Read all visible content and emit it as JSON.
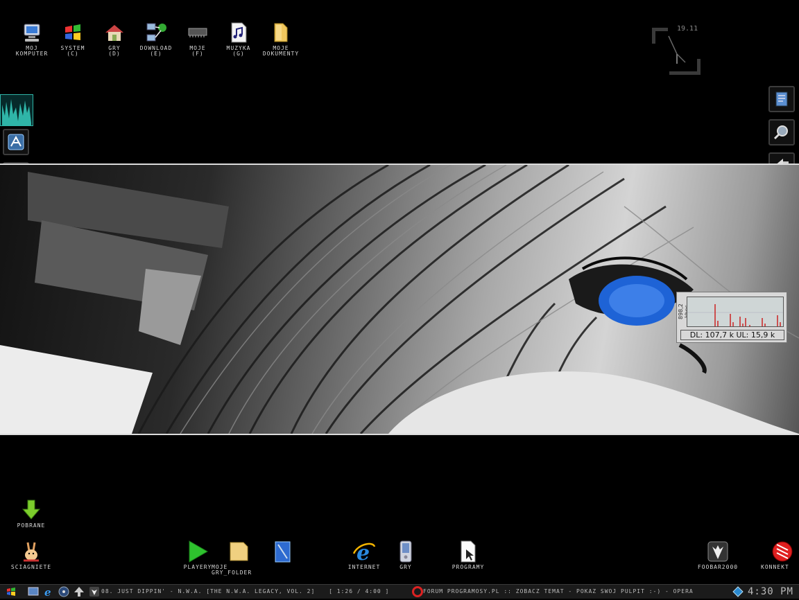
{
  "desktop_icons_top": [
    {
      "label": "MOJ\nKOMPUTER",
      "icon": "computer-icon"
    },
    {
      "label": "SYSTEM\n(C)",
      "icon": "windows-logo-icon"
    },
    {
      "label": "GRY\n(D)",
      "icon": "home-icon"
    },
    {
      "label": "DOWNLOAD\n(E)",
      "icon": "network-icon"
    },
    {
      "label": "MOJE\n(F)",
      "icon": "memory-chip-icon"
    },
    {
      "label": "MUZYKA\n(G)",
      "icon": "music-file-icon"
    },
    {
      "label": "MOJE\nDOKUMENTY",
      "icon": "folder-icon"
    }
  ],
  "clock": {
    "time": "19.11"
  },
  "desktop_icons_bottom": [
    {
      "label": "POBRANE",
      "icon": "download-arrow-icon"
    },
    {
      "label": "SCIAGNIETE",
      "icon": "bunny-icon"
    },
    {
      "label": "PLAYERY",
      "icon": "play-icon"
    },
    {
      "label": "MOJE GRY_FOLDER",
      "icon": "folder-icon"
    },
    {
      "label": "INTERNET",
      "icon": "internet-explorer-icon"
    },
    {
      "label": "GRY",
      "icon": "pda-icon"
    },
    {
      "label": "PROGRAMY",
      "icon": "document-cursor-icon"
    },
    {
      "label": "FOOBAR2000",
      "icon": "foobar-icon"
    },
    {
      "label": "KONNEKT",
      "icon": "konnekt-icon"
    }
  ],
  "left_dock": [
    "visualizer-icon",
    "app-icon",
    "folder-icon",
    "folder-icon",
    "music-note-icon",
    "firefox-icon"
  ],
  "right_dock": [
    "notepad-icon",
    "search-icon",
    "back-arrow-icon",
    "folder-icon",
    "folder-icon",
    "info-icon"
  ],
  "netmeter": {
    "rate_label": "898,2 kbps",
    "readout": "DL: 107,7 k  UL: 15,9 k"
  },
  "taskbar": {
    "now_playing": "08. JUST DIPPIN' - N.W.A. [THE N.W.A. LEGACY, VOL. 2]",
    "track_time": "[ 1:26 / 4:00 ]",
    "window_title": "FORUM PROGRAMOSY.PL :: ZOBACZ TEMAT - POKAZ SWOJ PULPIT :-) - OPERA",
    "tray_time": "4:30 PM"
  },
  "colors": {
    "accent_teal": "#2fb5a8",
    "meter_red": "#cc2222"
  }
}
